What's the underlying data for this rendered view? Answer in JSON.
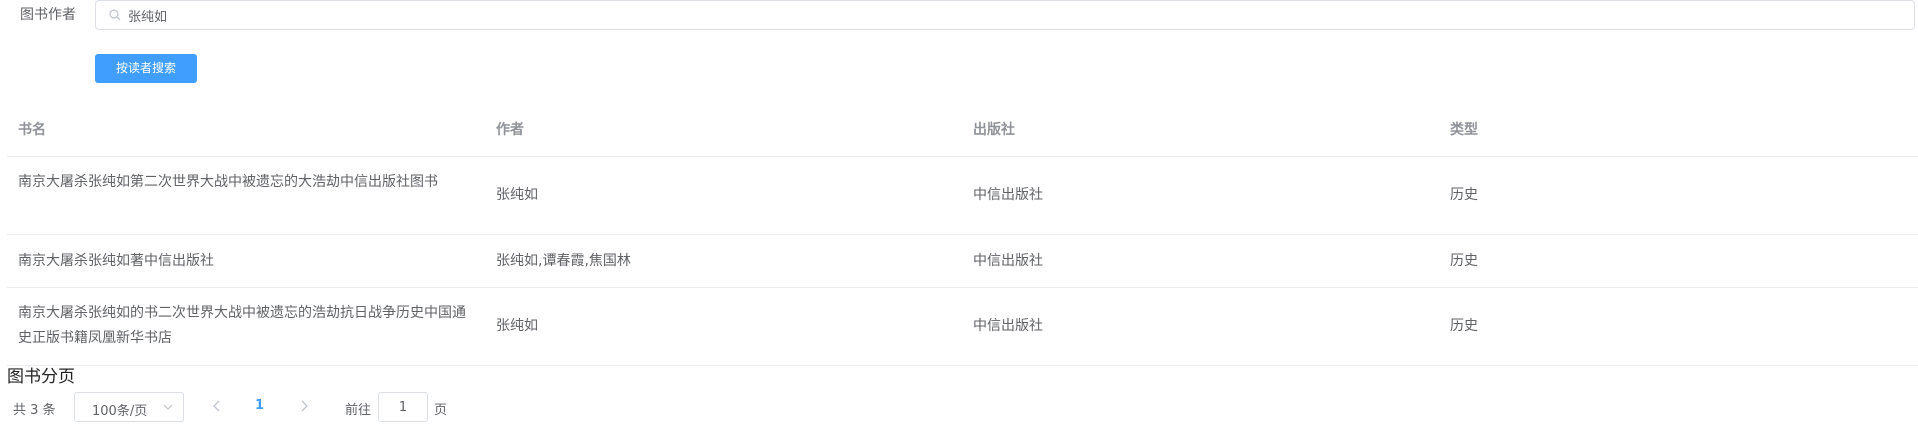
{
  "search": {
    "label": "图书作者",
    "value": "张纯如",
    "button_label": "按读者搜索"
  },
  "table": {
    "headers": [
      "书名",
      "作者",
      "出版社",
      "类型"
    ],
    "rows": [
      {
        "title": "南京大屠杀张纯如第二次世界大战中被遗忘的大浩劫中信出版社图书",
        "author": "张纯如",
        "publisher": "中信出版社",
        "type": "历史"
      },
      {
        "title": "南京大屠杀张纯如著中信出版社",
        "author": "张纯如,谭春霞,焦国林",
        "publisher": "中信出版社",
        "type": "历史"
      },
      {
        "title": "南京大屠杀张纯如的书二次世界大战中被遗忘的浩劫抗日战争历史中国通史正版书籍凤凰新华书店",
        "author": "张纯如",
        "publisher": "中信出版社",
        "type": "历史"
      }
    ]
  },
  "pagination": {
    "title": "图书分页",
    "total_text": "共 3 条",
    "page_size": "100条/页",
    "current_page": "1",
    "goto_label": "前往",
    "goto_value": "1",
    "goto_suffix": "页"
  },
  "colors": {
    "primary": "#409eff",
    "border": "#dcdfe6",
    "header_text": "#909399",
    "body_text": "#606266"
  }
}
